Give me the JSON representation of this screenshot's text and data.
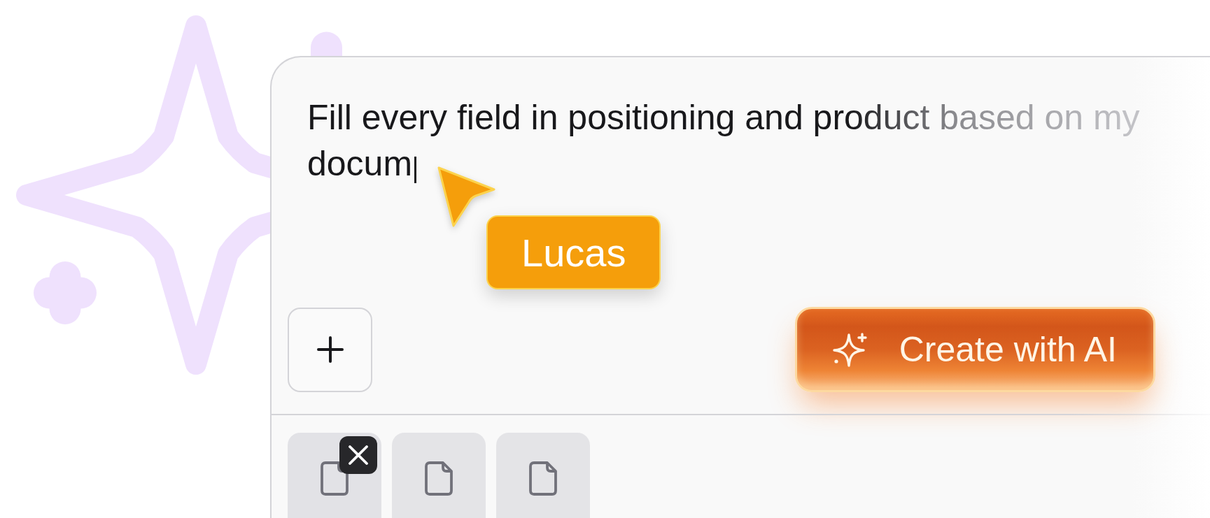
{
  "prompt": {
    "value": "Fill every field in positioning and product based on my docum",
    "focused": true
  },
  "collaborators": [
    {
      "name": "Lucas",
      "color": "#f59e0b"
    }
  ],
  "create_button": {
    "label": "Create with AI"
  },
  "attachments": [
    {
      "hovered": true
    },
    {
      "hovered": false
    },
    {
      "hovered": false
    }
  ]
}
